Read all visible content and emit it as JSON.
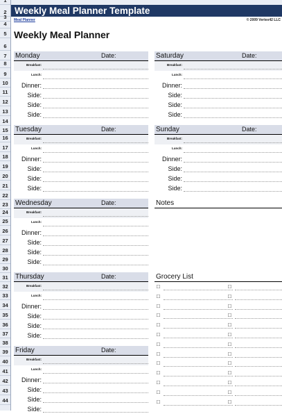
{
  "header": {
    "title": "Weekly Meal Planner Template",
    "link": "Meal Planner",
    "copyright": "© 2009 Vertex42 LLC"
  },
  "page_title": "Weekly Meal Planner",
  "row_numbers": [
    "1",
    "2",
    "3",
    "4",
    "5",
    "6",
    "7",
    "8",
    "9",
    "10",
    "11",
    "12",
    "13",
    "14",
    "15",
    "16",
    "17",
    "18",
    "19",
    "20",
    "21",
    "22",
    "23",
    "24",
    "25",
    "26",
    "27",
    "28",
    "29",
    "30",
    "31",
    "32",
    "33",
    "34",
    "35",
    "36",
    "37",
    "38",
    "39",
    "40",
    "41",
    "42",
    "43",
    "44"
  ],
  "date_label": "Date:",
  "meal_labels": {
    "breakfast": "Breakfast:",
    "lunch": "Lunch:",
    "dinner": "Dinner:",
    "side": "Side:"
  },
  "days_left": [
    "Monday",
    "Tuesday",
    "Wednesday",
    "Thursday",
    "Friday"
  ],
  "days_right": [
    "Saturday",
    "Sunday"
  ],
  "notes_label": "Notes",
  "grocery_label": "Grocery List",
  "bullet": "□",
  "colors": {
    "title_bg": "#1f3864",
    "header_bg": "#d9dde8"
  }
}
